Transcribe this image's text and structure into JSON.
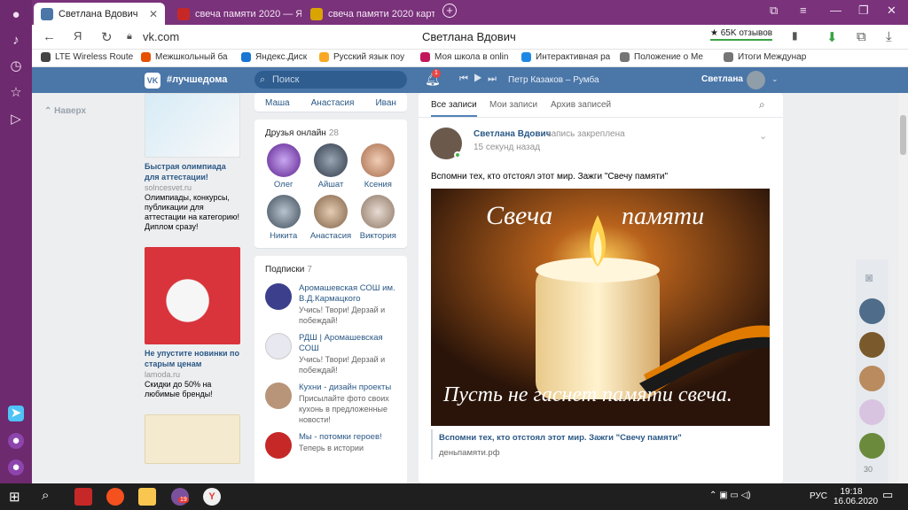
{
  "browser": {
    "tabs": [
      {
        "title": "Светлана Вдович",
        "favicon_color": "#4a76a8"
      },
      {
        "title": "свеча памяти 2020 — Янд",
        "favicon_color": "#c62828"
      },
      {
        "title": "свеча памяти 2020 картин",
        "favicon_color": "#d9a400"
      }
    ],
    "address": "vk.com",
    "page_title": "Светлана Вдович",
    "reviews_badge": "★ 65K отзывов",
    "yandex_letter": "Я",
    "bookmarks": [
      {
        "label": "LTE Wireless Route",
        "color": "#444"
      },
      {
        "label": "Межшкольный ба",
        "color": "#e65100"
      },
      {
        "label": "Яндекс.Диск",
        "color": "#1976d2"
      },
      {
        "label": "Русский язык поу",
        "color": "#f9a825"
      },
      {
        "label": "Моя школа в onlin",
        "color": "#c2185b"
      },
      {
        "label": "Интерактивная ра",
        "color": "#1e88e5"
      },
      {
        "label": "Положение о Ме",
        "color": "#757575"
      },
      {
        "label": "Итоги Междунар",
        "color": "#757575"
      }
    ]
  },
  "vk_header": {
    "logo": "VK",
    "hashtag": "#лучшедома",
    "search_placeholder": "Поиск",
    "notifications": "1",
    "track": "Петр Казаков – Румба",
    "user_name": "Светлана"
  },
  "left_menu": {
    "back": "Наверх"
  },
  "ads": [
    {
      "title": "Быстрая олимпиада для аттестации!",
      "domain": "solncesvet.ru",
      "text": "Олимпиады, конкурсы, публикации для аттестации на категорию! Диплом сразу!",
      "color": "#cfe6f4"
    },
    {
      "title": "Не упустите новинки по старым ценам",
      "domain": "lamoda.ru",
      "text": "Скидки до 50% на любимые бренды!",
      "color": "#d9343b"
    },
    {
      "title": "",
      "domain": "",
      "text": "",
      "color": "#f3ead0"
    }
  ],
  "friends_top": [
    "Маша",
    "Анастасия",
    "Иван"
  ],
  "friends_online": {
    "title": "Друзья онлайн",
    "count": "28",
    "people": [
      {
        "name": "Олег",
        "color": "#8a3fc4"
      },
      {
        "name": "Айшат",
        "color": "#3d4a5c"
      },
      {
        "name": "Ксения",
        "color": "#c98b6a"
      },
      {
        "name": "Никита",
        "color": "#5b6b7c"
      },
      {
        "name": "Анастасия",
        "color": "#9a7b5e"
      },
      {
        "name": "Виктория",
        "color": "#b49c8a"
      }
    ]
  },
  "subscriptions": {
    "title": "Подписки",
    "count": "7",
    "items": [
      {
        "name": "Аромашевская СОШ им. В.Д.Кармацкого",
        "desc": "Учись! Твори! Дерзай и побеждай!",
        "color": "#3b3f8c"
      },
      {
        "name": "РДШ | Аромашевская СОШ",
        "desc": "Учись! Твори! Дерзай и побеждай!",
        "color": "#e8e8f0"
      },
      {
        "name": "Кухни - дизайн проекты",
        "desc": "Присылайте фото своих кухонь в предложенные новости!",
        "color": "#b89478"
      },
      {
        "name": "Мы - потомки героев!",
        "desc": "Теперь в истории",
        "color": "#c62828"
      }
    ]
  },
  "wall": {
    "tabs": [
      "Все записи",
      "Мои записи",
      "Архив записей"
    ],
    "post": {
      "author": "Светлана Вдович",
      "action": "запись закреплена",
      "time": "15 секунд назад",
      "text": "Вспомни тех, кто отстоял этот мир. Зажги \"Свечу памяти\"",
      "image_title_1": "Свеча",
      "image_title_2": "памяти",
      "image_caption": "Пусть не гаснет памяти свеча.",
      "link_title": "Вспомни тех, кто отстоял этот мир. Зажги \"Свечу памяти\"",
      "link_domain": "деньпамяти.рф"
    }
  },
  "minichat": {
    "count": "30"
  },
  "taskbar": {
    "lang": "РУС",
    "time": "19:18",
    "date": "16.06.2020",
    "viber_badge": "19"
  }
}
